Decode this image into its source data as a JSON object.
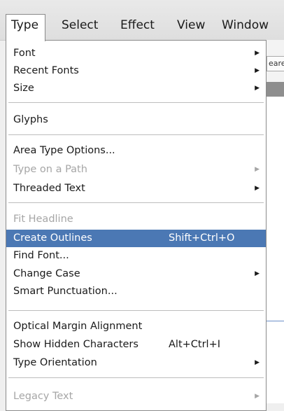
{
  "menubar": {
    "items": [
      {
        "label": "Type"
      },
      {
        "label": "Select"
      },
      {
        "label": "Effect"
      },
      {
        "label": "View"
      },
      {
        "label": "Window"
      }
    ]
  },
  "background": {
    "field_text": "eare"
  },
  "menu": {
    "groups": [
      {
        "items": [
          {
            "label": "Font",
            "submenu": true,
            "enabled": true
          },
          {
            "label": "Recent Fonts",
            "submenu": true,
            "enabled": true
          },
          {
            "label": "Size",
            "submenu": true,
            "enabled": true
          }
        ]
      },
      {
        "items": [
          {
            "label": "Glyphs",
            "enabled": true
          }
        ]
      },
      {
        "items": [
          {
            "label": "Area Type Options...",
            "enabled": true
          },
          {
            "label": "Type on a Path",
            "submenu": true,
            "enabled": false
          },
          {
            "label": "Threaded Text",
            "submenu": true,
            "enabled": true
          }
        ]
      },
      {
        "items": [
          {
            "label": "Fit Headline",
            "enabled": false
          },
          {
            "label": "Create Outlines",
            "shortcut": "Shift+Ctrl+O",
            "enabled": true,
            "highlighted": true
          },
          {
            "label": "Find Font...",
            "enabled": true
          },
          {
            "label": "Change Case",
            "submenu": true,
            "enabled": true
          },
          {
            "label": "Smart Punctuation...",
            "enabled": true
          }
        ]
      },
      {
        "items": [
          {
            "label": "Optical Margin Alignment",
            "enabled": true
          },
          {
            "label": "Show Hidden Characters",
            "shortcut": "Alt+Ctrl+I",
            "enabled": true
          },
          {
            "label": "Type Orientation",
            "submenu": true,
            "enabled": true
          }
        ]
      },
      {
        "items": [
          {
            "label": "Legacy Text",
            "submenu": true,
            "enabled": false
          }
        ]
      }
    ]
  },
  "colors": {
    "highlight": "#4b78b4",
    "disabled_text": "#a6a6a6"
  }
}
